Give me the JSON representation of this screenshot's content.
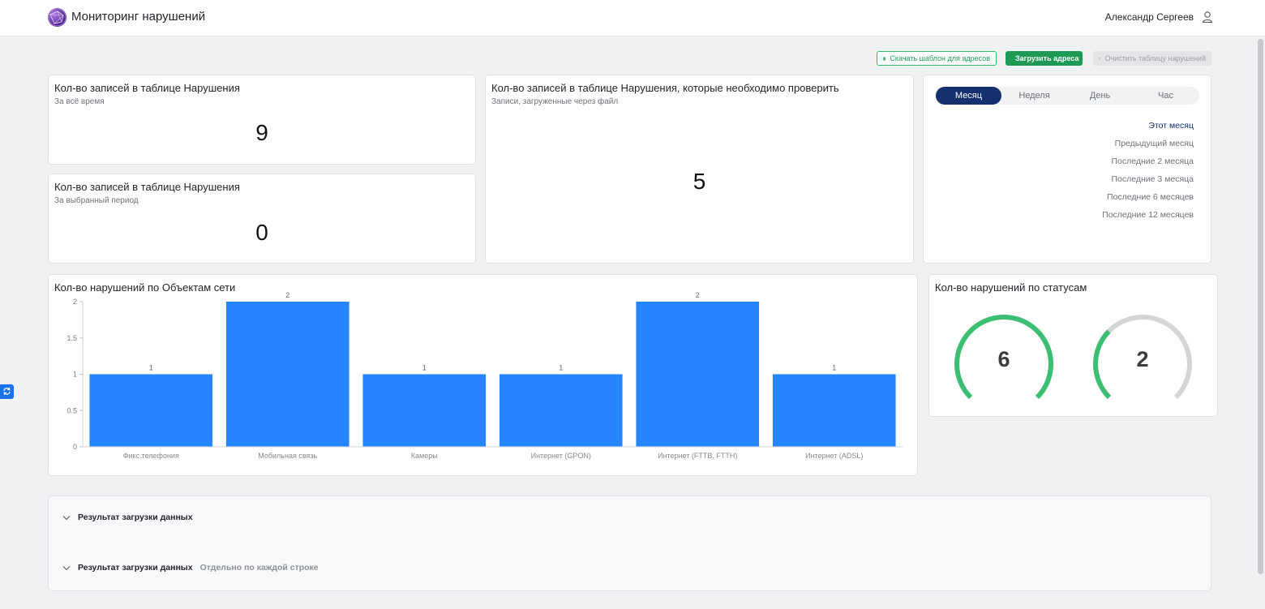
{
  "header": {
    "app_title": "Мониторинг нарушений",
    "user_name": "Александр Сергеев",
    "logo_icon": "globe-logo-icon",
    "user_icon": "user-icon"
  },
  "toolbar": {
    "download_template": "Скачать шаблон для адресов",
    "upload_addresses": "Загрузить адреса",
    "clear_table": "Очистить таблицу нарушений"
  },
  "cards": {
    "total_all_time": {
      "title": "Кол-во записей в таблице Нарушения",
      "subtitle": "За всё время",
      "value": "9"
    },
    "total_period": {
      "title": "Кол-во записей в таблице Нарушения",
      "subtitle": "За выбранный период",
      "value": "0"
    },
    "to_check": {
      "title": "Кол-во записей в таблице Нарушения, которые необходимо проверить",
      "subtitle": "Записи, загруженные через файл",
      "value": "5"
    }
  },
  "period_filter": {
    "tabs": [
      {
        "label": "Месяц",
        "active": true
      },
      {
        "label": "Неделя",
        "active": false
      },
      {
        "label": "День",
        "active": false
      },
      {
        "label": "Час",
        "active": false
      }
    ],
    "options": [
      {
        "label": "Этот месяц",
        "active": true
      },
      {
        "label": "Предыдущий месяц",
        "active": false
      },
      {
        "label": "Последние 2 месяца",
        "active": false
      },
      {
        "label": "Последние 3 месяца",
        "active": false
      },
      {
        "label": "Последние 6 месяцев",
        "active": false
      },
      {
        "label": "Последние 12 месяцев",
        "active": false
      }
    ]
  },
  "objects_chart_title": "Кол-во нарушений по Объектам сети",
  "status_chart_title": "Кол-во нарушений по статусам",
  "chart_data": [
    {
      "type": "bar",
      "title": "Кол-во нарушений по Объектам сети",
      "categories": [
        "Фикс.телефония",
        "Мобильная связь",
        "Камеры",
        "Интернет (GPON)",
        "Интернет (FTTB, FTTH)",
        "Интернет (ADSL)"
      ],
      "values": [
        1,
        2,
        1,
        1,
        2,
        1
      ],
      "ylim": [
        0,
        2
      ],
      "yticks": [
        "0",
        "0.5",
        "1",
        "1.5",
        "2"
      ],
      "color": "#2684ff",
      "grid": false,
      "legend": "none"
    },
    {
      "type": "gauge",
      "title": "Кол-во нарушений по статусам",
      "gauges": [
        {
          "value": 6,
          "fill_fraction": 1.0,
          "color": "#3cbf73"
        },
        {
          "value": 2,
          "fill_fraction": 0.33,
          "color": "#3cbf73"
        }
      ],
      "track_color": "#d5d5d5"
    }
  ],
  "accordion": [
    {
      "label": "Результат загрузки данных",
      "sub": ""
    },
    {
      "label": "Результат загрузки данных",
      "sub": "Отдельно по каждой строке"
    }
  ]
}
